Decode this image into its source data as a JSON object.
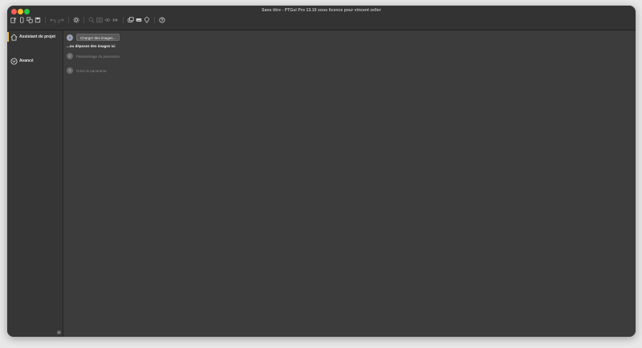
{
  "window": {
    "title": "Sans titre - PTGui Pro 13.10 sous licence pour vincent zeller"
  },
  "toolbar": {
    "icons": [
      "edit-icon",
      "phone-icon",
      "copy-icon",
      "save-icon",
      "undo-icon",
      "redo-icon",
      "settings-icon",
      "search-icon",
      "image-search-icon",
      "eye-icon",
      "fast-forward-icon",
      "layers-icon",
      "panorama-icon",
      "location-icon",
      "help-icon"
    ]
  },
  "sidebar": {
    "items": [
      {
        "label": "Assistant de projet",
        "icon": "home-icon"
      },
      {
        "label": "Avancé",
        "icon": "chevron-down-circle-icon"
      }
    ]
  },
  "main": {
    "steps": [
      {
        "number": "1",
        "button_label": "Charger des images..."
      },
      {
        "number": "2",
        "label": "Paramétrage du panorama"
      },
      {
        "number": "3",
        "label": "Créer le panorama"
      }
    ],
    "drop_hint": "...ou déposez des images ici"
  }
}
